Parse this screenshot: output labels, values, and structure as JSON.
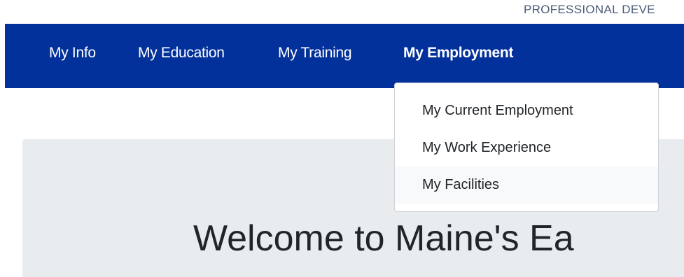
{
  "header": {
    "program_title": "PROFESSIONAL DEVE"
  },
  "nav": {
    "items": [
      {
        "label": "My Info"
      },
      {
        "label": "My Education"
      },
      {
        "label": "My Training"
      },
      {
        "label": "My Employment"
      }
    ],
    "active_index": 3
  },
  "dropdown": {
    "items": [
      {
        "label": "My Current Employment"
      },
      {
        "label": "My Work Experience"
      },
      {
        "label": "My Facilities"
      }
    ],
    "hovered_index": 2
  },
  "hero": {
    "title": "Welcome to Maine's Ea"
  },
  "colors": {
    "navbar_bg": "#03319b",
    "hero_bg": "#e9ecef",
    "nav_text": "#ffffff"
  }
}
